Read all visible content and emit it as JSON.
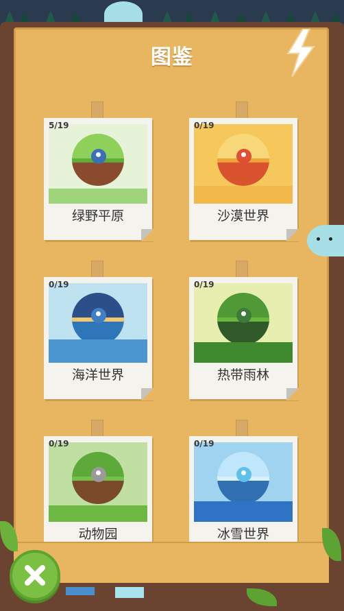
{
  "header": {
    "title": "图鉴"
  },
  "cards": [
    {
      "count": "5/19",
      "label": "绿野平原",
      "sky": "#e7f3d9",
      "hill": "#8fd05a",
      "soil": "#8a4a2e",
      "ground": "#5fae3a",
      "critter": "#3d6fb5"
    },
    {
      "count": "0/19",
      "label": "沙漠世界",
      "sky": "#f6c75a",
      "hill": "#f3a94a",
      "soil": "#d9532f",
      "ground": "#f0a23b",
      "critter": "#e04e34"
    },
    {
      "count": "0/19",
      "label": "海洋世界",
      "sky": "#bfe2f0",
      "hill": "#2c4f8a",
      "soil": "#2f76b8",
      "ground": "#f2c66a",
      "critter": "#3f7fc3"
    },
    {
      "count": "0/19",
      "label": "热带雨林",
      "sky": "#e6efb0",
      "hill": "#4f9a37",
      "soil": "#315a2a",
      "ground": "#6bb73d",
      "critter": "#3e7a39"
    },
    {
      "count": "0/19",
      "label": "动物园",
      "sky": "#bfe0a2",
      "hill": "#5daa3a",
      "soil": "#7b4a2b",
      "ground": "#73c04a",
      "critter": "#9a9a9a"
    },
    {
      "count": "0/19",
      "label": "冰雪世界",
      "sky": "#9fd3f0",
      "hill": "#3f8fd6",
      "soil": "#2f6fb2",
      "ground": "#d8f0fb",
      "critter": "#5fc0ea"
    }
  ],
  "colors": {
    "board": "#e8b660",
    "frame": "#6b4431",
    "close_button": "#7bc043"
  },
  "icons": {
    "close": "close-icon",
    "lightning": "lightning-icon"
  }
}
